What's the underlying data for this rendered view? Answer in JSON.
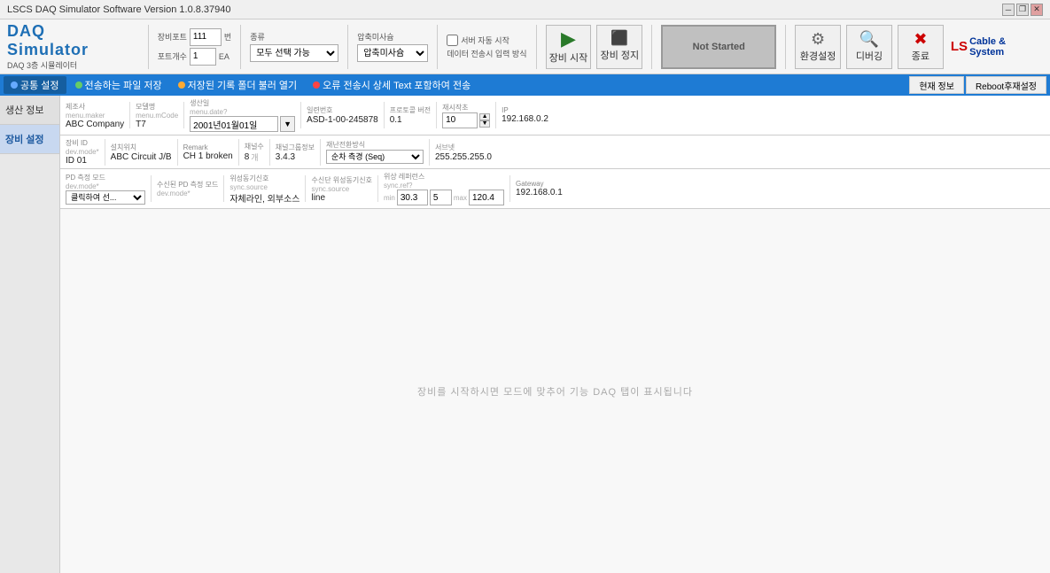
{
  "titleBar": {
    "title": "LSCS DAQ Simulator Software Version 1.0.8.37940"
  },
  "logo": {
    "main": "DAQ Simulator",
    "sub": "DAQ 3층 시뮬레이터"
  },
  "toolbar": {
    "port_label": "장비포트",
    "port_value": "111",
    "port_unit": "번",
    "port_sub_label": "포트개수",
    "port_sub_value": "1",
    "port_sub_unit": "EA",
    "type_label": "종류",
    "type_value": "모두 선택 가능",
    "pressure_label": "압축미사슘",
    "auto_server_label": "서버 자동 시작",
    "data_input_label": "데이터 전송시 입력 방식",
    "start_label": "장비 시작",
    "stop_label": "장비 정지",
    "check_label": "환경설정",
    "debug_label": "디버깅",
    "exit_label": "종료",
    "not_started": "Not Started"
  },
  "tabs": [
    {
      "id": "common",
      "label": "공통 설정",
      "dot": "blue",
      "active": true
    },
    {
      "id": "send_file",
      "label": "전송하는 파일 저장",
      "dot": "green",
      "active": false
    },
    {
      "id": "log",
      "label": "저장된 기록 폴더 불러 열기",
      "dot": "orange",
      "active": false
    },
    {
      "id": "error",
      "label": "오류 전송시 상세 Text 포함하여 전송",
      "dot": "red",
      "active": false
    }
  ],
  "tabRight": {
    "current_info": "현재 정보",
    "reboot": "Reboot후재설정"
  },
  "sidebar": {
    "items": [
      {
        "id": "device-info",
        "label": "생산 정보",
        "active": false
      },
      {
        "id": "device-settings",
        "label": "장비 설정",
        "active": true
      }
    ]
  },
  "deviceInfo": {
    "maker_label": "제조사",
    "maker_sub": "menu.maker",
    "maker_value": "ABC Company",
    "model_label": "모델명",
    "model_sub": "menu.mCode",
    "model_value": "T7",
    "date_label": "생산일",
    "date_sub": "menu.date?",
    "date_value": "2001년01월01일",
    "serial_label": "일련번호",
    "serial_value": "ASD-1-00-245878",
    "protocol_label": "프로토콜 버전",
    "protocol_value": "0.1",
    "restart_label": "재시작초",
    "restart_value": "10",
    "ip_label": "IP",
    "ip_value": "192.168.0.2"
  },
  "deviceSettings": {
    "equipment_id_label": "장비 ID",
    "equipment_id_sub": "dev.mode*",
    "equipment_id_value": "ID 01",
    "install_label": "설치위치",
    "install_value": "ABC Circuit J/B",
    "remark_label": "Remark",
    "remark_value": "CH 1 broken",
    "channel_count_label": "채널수",
    "channel_count_value": "8",
    "channel_group_label": "채널그룹정보",
    "channel_group_value": "3.4.3",
    "disaster_label": "재난전환방식",
    "disaster_value": "순차 측경 (Seq)",
    "subnet_label": "서브넷",
    "subnet_value": "255.255.255.0",
    "pd_mode_label": "PD 측정 모드",
    "pd_mode_sub": "dev.mode*",
    "pd_mode_value": "클릭하여 선...",
    "recv_pd_label": "수신된 PD 측정 모드",
    "recv_pd_sub": "dev.mode*",
    "sync_source_label": "위성동기신호",
    "sync_source_sub": "sync.source",
    "sync_source_value": "자체라인, 외부소스",
    "recv_sync_label": "수신단 위성동기신호",
    "recv_sync_sub": "sync.source",
    "recv_sync_value": "line",
    "sync_ref_label": "위상 레퍼런스",
    "sync_ref_sub": "sync.ref?",
    "sync_ref_min": "30.3",
    "sync_ref_val": "5",
    "sync_ref_max": "120.4",
    "gateway_label": "Gateway",
    "gateway_value": "192.168.0.1"
  },
  "emptyState": {
    "message": "장비를 시작하시면 모드에 맞추어 기능 DAQ 탭이 표시됩니다"
  }
}
